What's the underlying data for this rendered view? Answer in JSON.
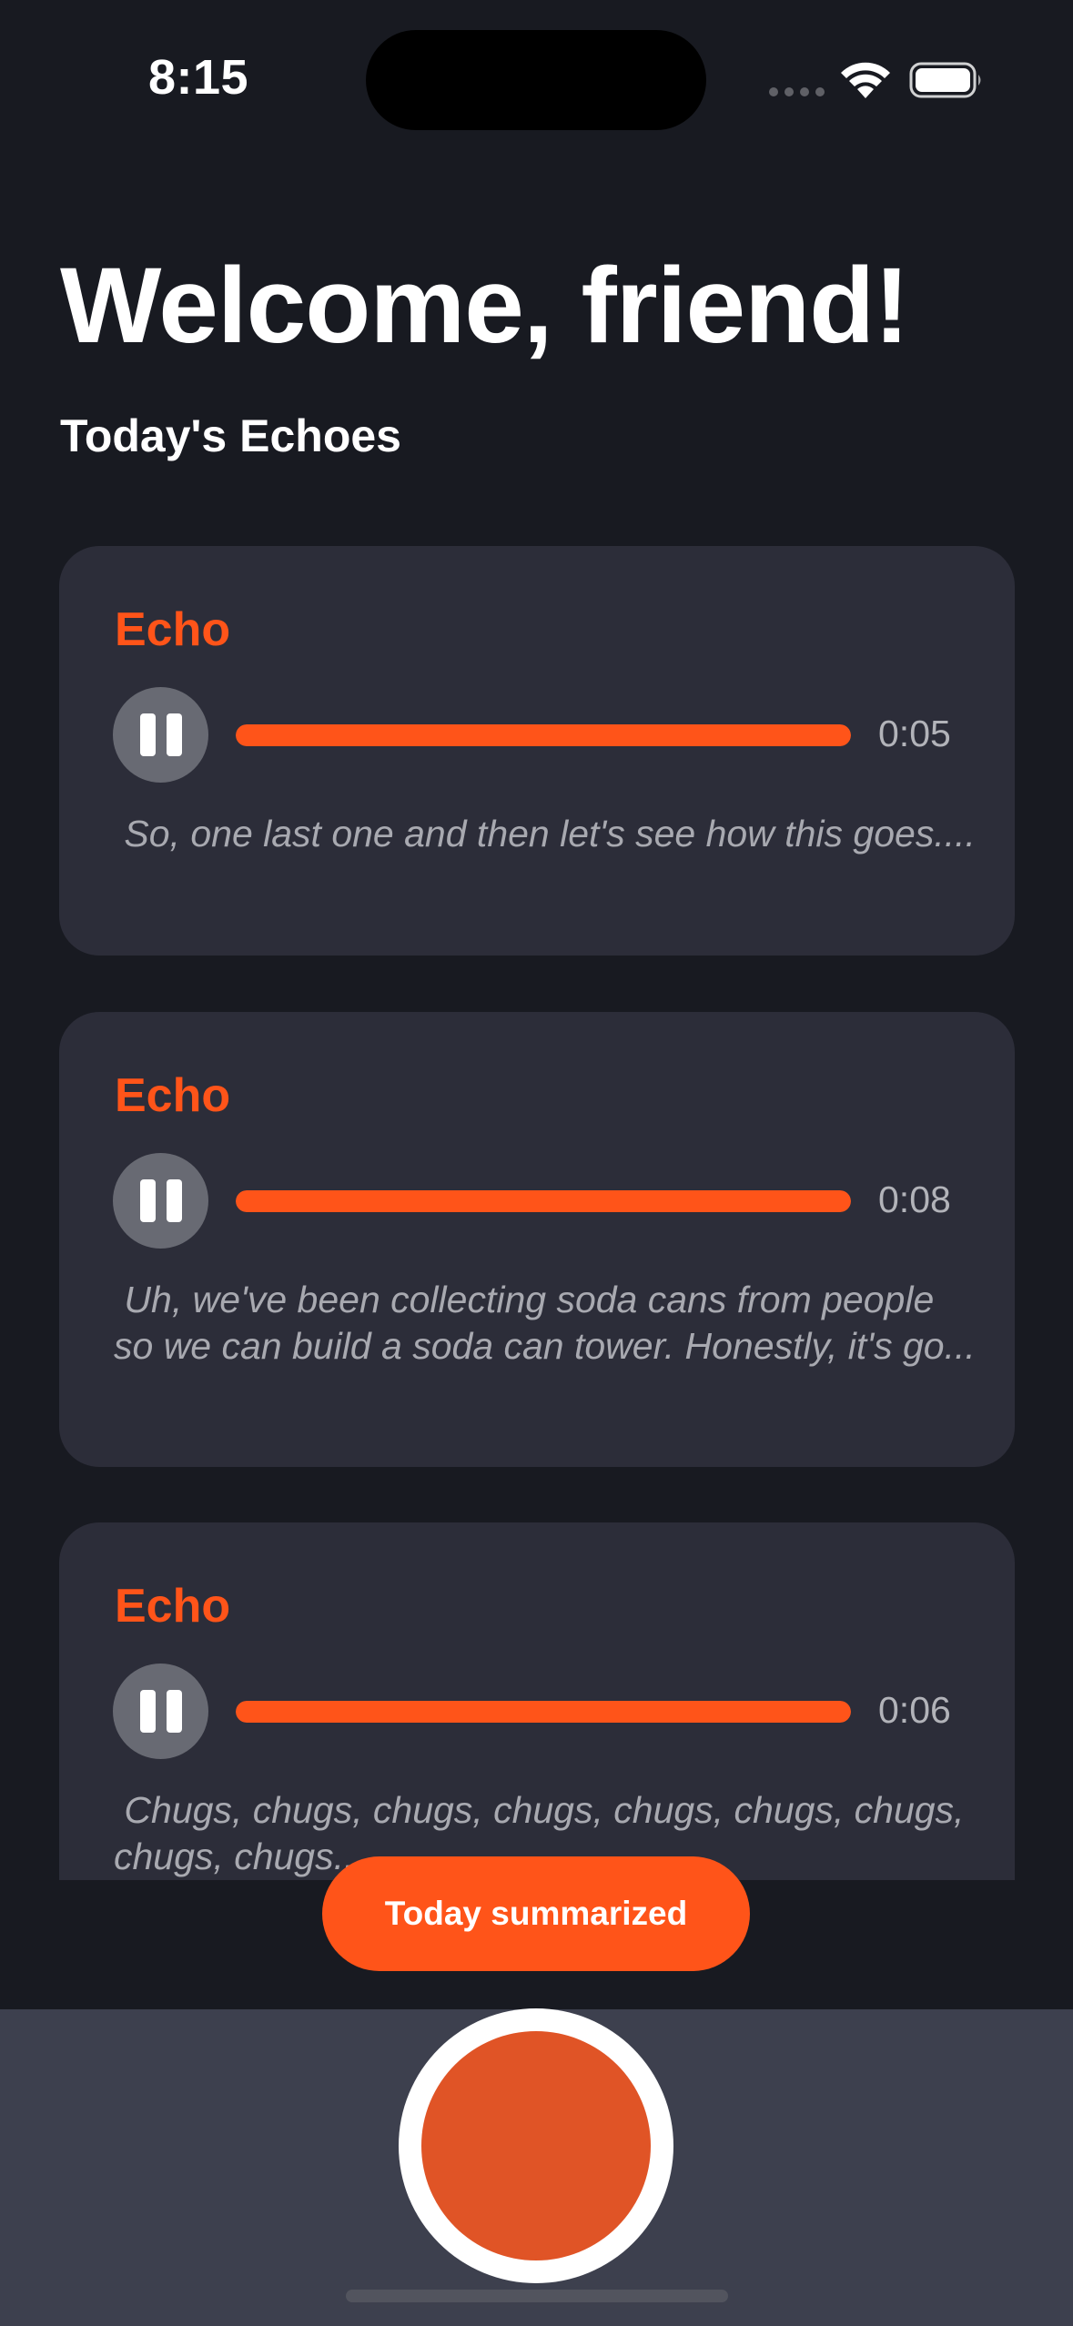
{
  "status_bar": {
    "time": "8:15",
    "icons": [
      "signal-dots-icon",
      "wifi-icon",
      "battery-icon"
    ]
  },
  "header": {
    "title": "Welcome, friend!",
    "section_title": "Today's Echoes"
  },
  "echoes": [
    {
      "title": "Echo",
      "duration": "0:05",
      "progress_fraction": 1.0,
      "transcript": " So, one last one and then let's see how this goes....",
      "icon": "pause-icon"
    },
    {
      "title": "Echo",
      "duration": "0:08",
      "progress_fraction": 1.0,
      "transcript": " Uh, we've been collecting soda cans from people so we can build a soda can tower. Honestly, it's go...",
      "icon": "pause-icon"
    },
    {
      "title": "Echo",
      "duration": "0:06",
      "progress_fraction": 1.0,
      "transcript": " Chugs, chugs, chugs, chugs, chugs, chugs, chugs, chugs, chugs...",
      "icon": "pause-icon"
    }
  ],
  "actions": {
    "summary_label": "Today summarized",
    "record_icon": "record-icon"
  },
  "colors": {
    "accent": "#ff5419",
    "background": "#181a21",
    "card": "#2c2d39",
    "dock": "#3d404e",
    "record": "#e05426"
  }
}
